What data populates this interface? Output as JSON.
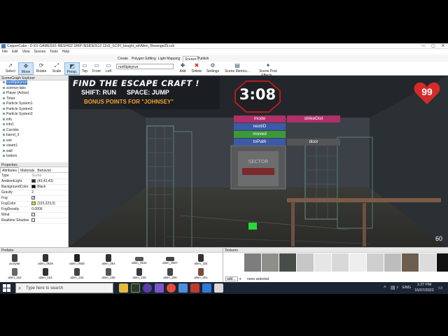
{
  "window": {
    "app_name": "CopperCube",
    "title": "CopperCube - D:\\01 GAMES\\01 MESH\\02 SHIP INSIDES\\12 12x5_SCIFI_bought_ok\\Alien_Revenge29.ccb",
    "controls": [
      "—",
      "▢",
      "✕"
    ]
  },
  "menu": [
    "File",
    "Edit",
    "View",
    "Scenes",
    "Tools",
    "Help"
  ],
  "ribbon_tabs": [
    "Create",
    "Polygon Editing",
    "Light Mapping",
    "Scenes",
    "Publish"
  ],
  "active_ribbon_tab": "Scenes",
  "toolbar": {
    "tools": [
      {
        "label": "Select",
        "icon": "cursor-icon"
      },
      {
        "label": "Move",
        "icon": "move-icon"
      },
      {
        "label": "Rotate",
        "icon": "rotate-icon"
      },
      {
        "label": "Scale",
        "icon": "scale-icon"
      },
      {
        "label": "Persp.",
        "icon": "perspective-icon"
      },
      {
        "label": "Top",
        "icon": "top-view-icon"
      },
      {
        "label": "Front",
        "icon": "front-view-icon"
      },
      {
        "label": "Left",
        "icon": "left-view-icon"
      }
    ],
    "scene_select_value": "runRipleyrun",
    "scene_actions": [
      {
        "label": "Add",
        "icon": "add-icon"
      },
      {
        "label": "Delete",
        "icon": "delete-icon"
      },
      {
        "label": "Settings",
        "icon": "settings-icon"
      },
      {
        "label": "Scene Metrics...",
        "icon": "metrics-icon"
      },
      {
        "label": "Scene Post Effects...",
        "icon": "effects-icon"
      }
    ]
  },
  "scenegraph": {
    "header": "SceneGraph Explorer",
    "selected": "runRipleyrun",
    "nodes": [
      "science-labs",
      "Player (Active)",
      "Timer",
      "Particle System1",
      "Particle System2",
      "Particle System3",
      "info",
      "info1",
      "Corridor",
      "barrel_3",
      "exit",
      "cleam1",
      "wall",
      "bottom"
    ]
  },
  "properties": {
    "header": "Properties",
    "tabs": [
      "Attributes",
      "Materials",
      "Behavior"
    ],
    "rows": [
      {
        "key": "Type",
        "value": "Scene"
      },
      {
        "key": "AmbientLight",
        "value": "(43,43,43)",
        "color": "#2b2b2b"
      },
      {
        "key": "BackgroundColor",
        "value": "Black",
        "color": "#000000"
      },
      {
        "key": "Gravity",
        "value": "2"
      },
      {
        "key": "Fog",
        "value": "",
        "checked": true
      },
      {
        "key": "FogColor",
        "value": "(223,223,0)",
        "color": "#dfdf00"
      },
      {
        "key": "FogDensity",
        "value": "0.0006"
      },
      {
        "key": "Wind",
        "value": "",
        "checked": false
      },
      {
        "key": "Realtime Shadow",
        "value": "",
        "checked": false
      }
    ]
  },
  "hud": {
    "title": "FIND THE ESCAPE CRAFT !",
    "controls": "SHIFT: RUN      SPACE: JUMP",
    "bonus": "BONUS POINTS FOR \"JOHNSEY\"",
    "timer": "3:08",
    "health": "99",
    "fps": "60",
    "debug_buttons": [
      {
        "label": "mode",
        "color": "#b0306a"
      },
      {
        "label": "strikeDist",
        "color": "#b0306a"
      },
      {
        "label": "nextID",
        "color": "#3b5aa8"
      },
      {
        "label": "moved",
        "color": "#3a9a3a"
      },
      {
        "label": "toPath",
        "color": "#3b5aa8"
      },
      {
        "label": "door",
        "color": "#555555"
      }
    ],
    "door_sign": "SECTOR"
  },
  "prefabs": {
    "header": "Prefabs",
    "items": [
      "acolyter",
      "alien_0k28",
      "alien_0k0b",
      "alien_0k4",
      "alien_0k41",
      "alien_0k07",
      "alien_1kk",
      "alien_1k2",
      "alien_1k3",
      "alien_1k4",
      "alien_1k5",
      "alien_1k6",
      "alien_2k6",
      "alien_2k1"
    ]
  },
  "textures": {
    "header": "Textures",
    "add_label": "add...",
    "status": "none selected"
  },
  "taskbar": {
    "search_placeholder": "Type here to search",
    "time": "1:27 PM",
    "date": "16/07/2022",
    "lang": "ENG"
  }
}
